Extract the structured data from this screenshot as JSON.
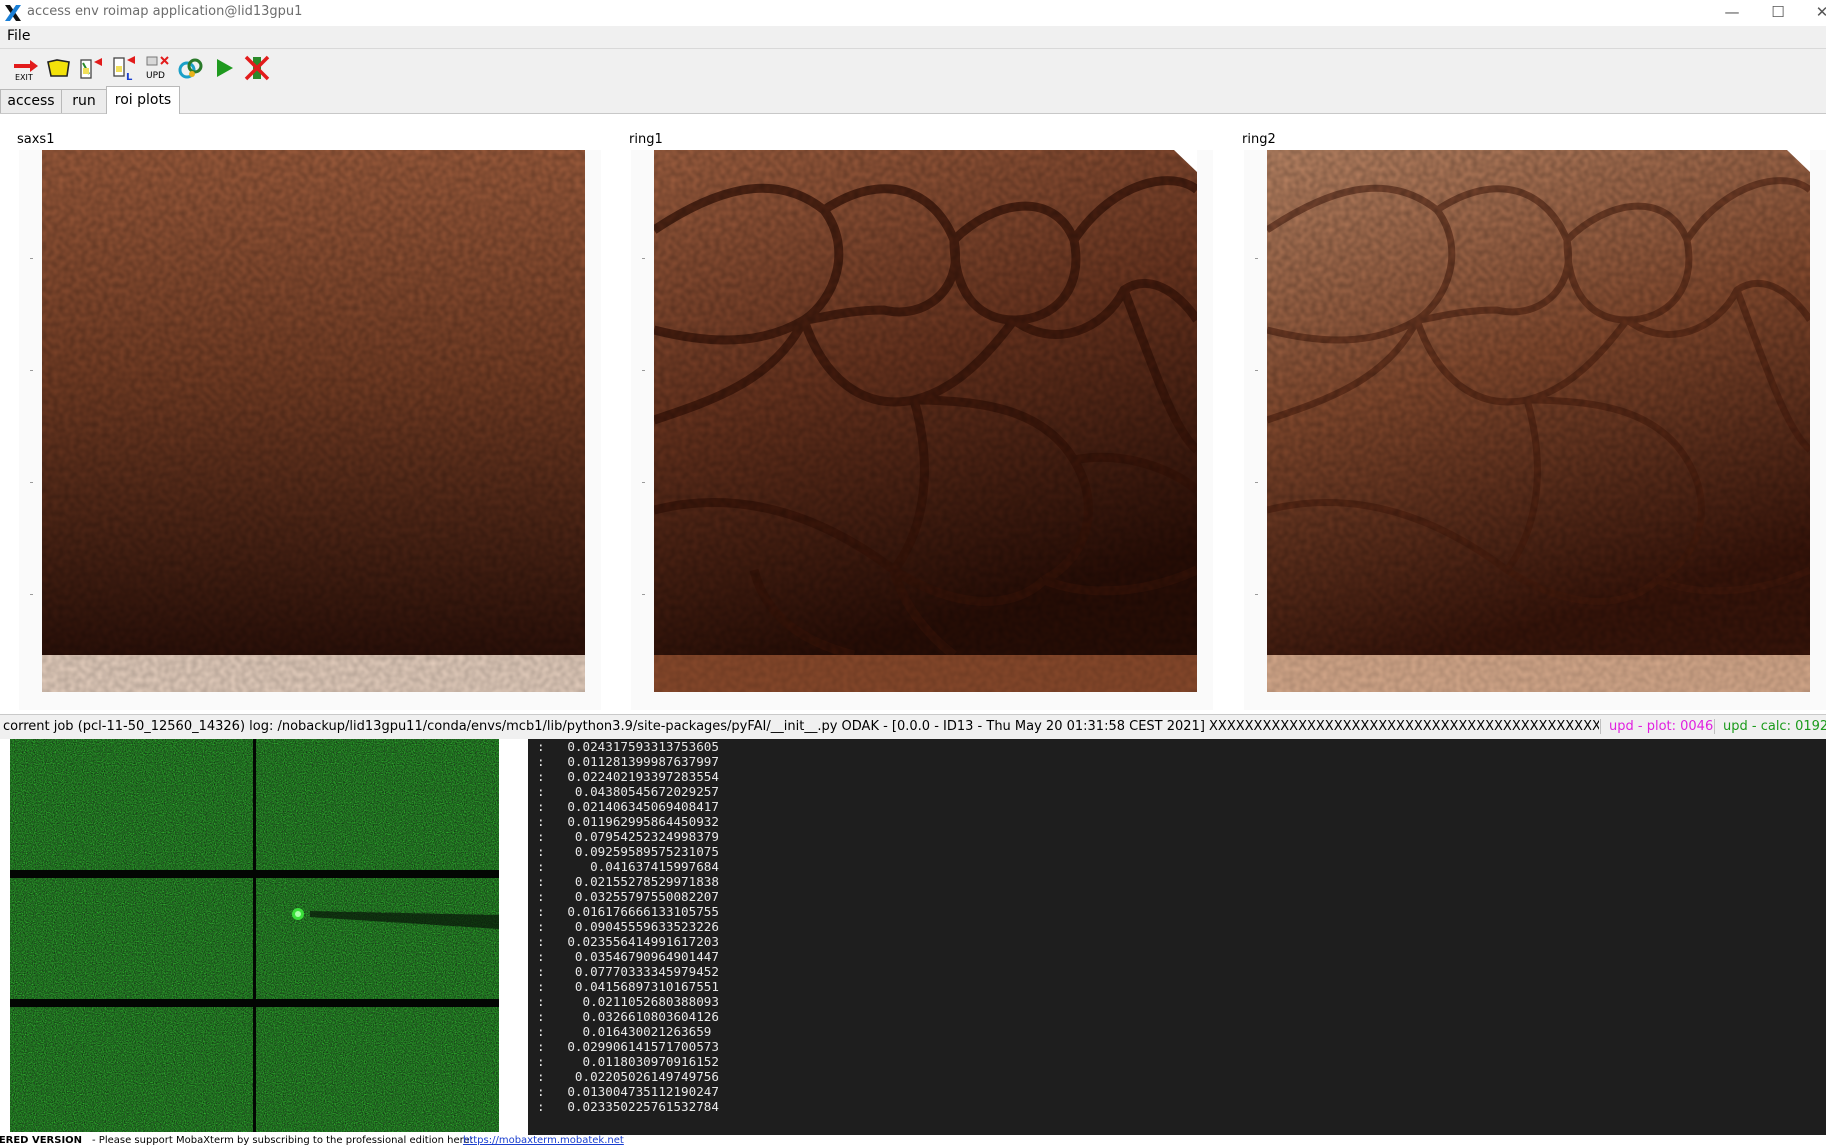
{
  "window": {
    "title": "access env roimap application@lid13gpu1",
    "minimize": "—",
    "maximize": "☐",
    "close": "✕"
  },
  "menu": {
    "file": "File"
  },
  "toolbar": {
    "exit_label": "EXIT",
    "upd_label": "UPD",
    "l_label": "L",
    "buttons": [
      "exit-icon",
      "open-folder-icon",
      "load-icon",
      "load-l-icon",
      "update-icon",
      "settings-icon",
      "run-play-icon",
      "stop-icon"
    ]
  },
  "tabs": [
    {
      "label": "access",
      "active": false
    },
    {
      "label": "run",
      "active": false
    },
    {
      "label": "roi plots",
      "active": true
    }
  ],
  "plots": [
    {
      "title": "saxs1"
    },
    {
      "title": "ring1"
    },
    {
      "title": "ring2"
    }
  ],
  "status": {
    "job": "corrent job (pcl-11-50_12560_14326) log: /nobackup/lid13gpu11/conda/envs/mcb1/lib/python3.9/site-packages/pyFAI/__init__.py  ODAK - [0.0.0 - ID13 - Thu May 20 01:31:58 CEST 2021] XXXXXXXXXXXXXXXXXXXXXXXXXXXXXXXXXXXXXXXXXXXXXXXXXXXXXXXXXXXX",
    "upd_plot": "upd - plot: 0046",
    "upd_calc": "upd - calc: 0192",
    "colors": {
      "upd_plot": "#e020e0",
      "upd_calc": "#1a9a1a"
    }
  },
  "console": {
    "lines": [
      ":   0.024317593313753605",
      ":   0.011281399987637997",
      ":   0.022402193397283554",
      ":    0.04380545672029257",
      ":   0.021406345069408417",
      ":   0.011962995864450932",
      ":    0.07954252324998379",
      ":    0.09259589575231075",
      ":      0.041637415997684",
      ":    0.02155278529971838",
      ":    0.03255797550082207",
      ":   0.016176666133105755",
      ":    0.09045559633523226",
      ":   0.023556414991617203",
      ":    0.03546790964901447",
      ":    0.07770333345979452",
      ":    0.04156897310167551",
      ":     0.0211052680388093",
      ":     0.0326610803604126",
      ":     0.016430021263659",
      ":   0.029906141571700573",
      ":     0.0118030970916152",
      ":    0.02205026149749756",
      ":   0.013004735112190247",
      ":   0.023350225761532784"
    ]
  },
  "footer": {
    "registered": "TERED VERSION",
    "message": " -  Please support MobaXterm by subscribing to the professional edition here:",
    "link": "https://mobaxterm.mobatek.net"
  }
}
